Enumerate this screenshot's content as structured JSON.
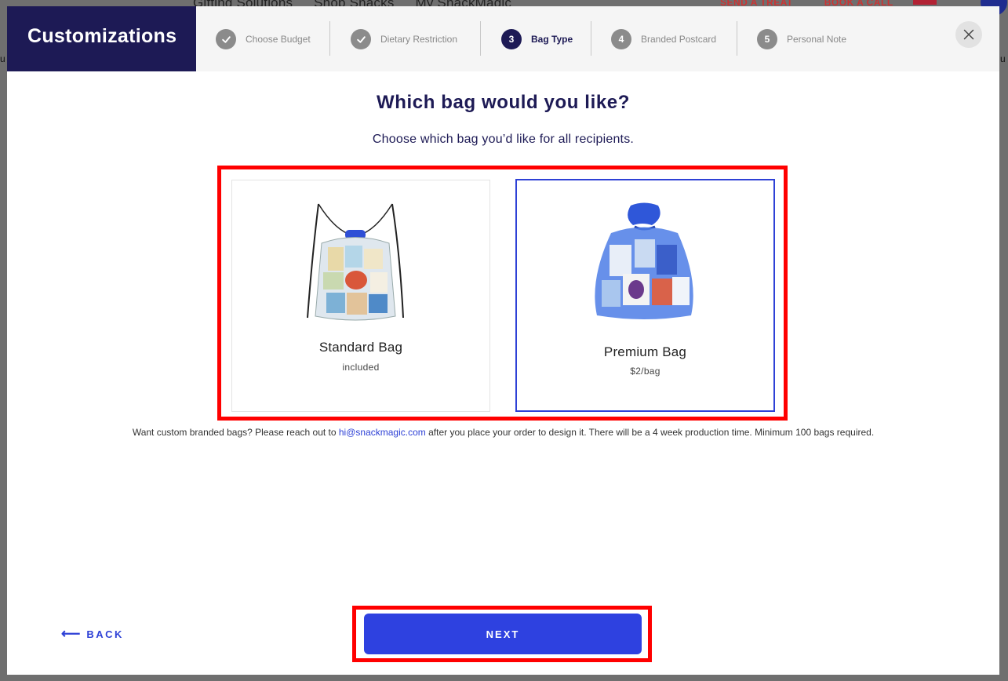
{
  "background": {
    "nav_links": [
      "Gifting Solutions",
      "Shop Snacks",
      "My SnackMagic"
    ],
    "nav_right": [
      "SEND A TREAT",
      "BOOK A CALL"
    ],
    "left_fragment": "u",
    "right_fragment": "u"
  },
  "modal": {
    "brand": "Customizations",
    "steps": [
      {
        "number": "1",
        "label": "Choose Budget",
        "state": "completed",
        "icon": "check-icon"
      },
      {
        "number": "2",
        "label": "Dietary Restriction",
        "state": "completed",
        "icon": "check-icon"
      },
      {
        "number": "3",
        "label": "Bag Type",
        "state": "active"
      },
      {
        "number": "4",
        "label": "Branded Postcard",
        "state": "upcoming"
      },
      {
        "number": "5",
        "label": "Personal Note",
        "state": "upcoming"
      }
    ],
    "close_icon": "close-icon",
    "title": "Which bag would you like?",
    "subtitle": "Choose which bag you’d like for all recipients.",
    "options": [
      {
        "name": "Standard Bag",
        "price": "included",
        "selected": false,
        "image": "clear-drawstring-bag"
      },
      {
        "name": "Premium Bag",
        "price": "$2/bag",
        "selected": true,
        "image": "blue-organza-bag"
      }
    ],
    "note": {
      "before": "Want custom branded bags? Please reach out to ",
      "email": "hi@snackmagic.com",
      "after": " after you place your order to design it. There will be a 4 week production time. Minimum 100 bags required."
    },
    "back_label": "BACK",
    "back_icon": "arrow-left-icon",
    "next_label": "NEXT"
  },
  "colors": {
    "brand_navy": "#1d1a55",
    "accent_blue": "#2e41e0",
    "highlight_red": "#ff0000"
  }
}
